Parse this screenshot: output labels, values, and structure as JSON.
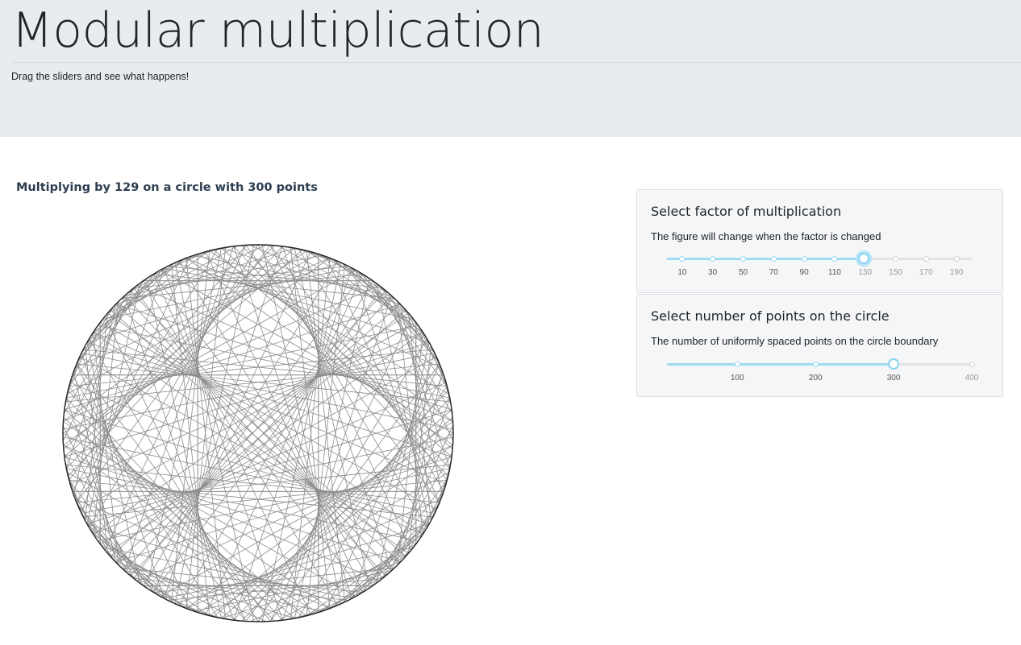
{
  "header": {
    "title": "Modular multiplication",
    "lead": "Drag the sliders and see what happens!"
  },
  "plot": {
    "title": "Multiplying by 129 on a circle with 300 points",
    "factor": 129,
    "points": 300
  },
  "factor_panel": {
    "title": "Select factor of multiplication",
    "description": "The figure will change when the factor is changed",
    "min": 0,
    "max": 200,
    "value": 129,
    "tick_labels": [
      "10",
      "30",
      "50",
      "70",
      "90",
      "110",
      "130",
      "150",
      "170",
      "190"
    ]
  },
  "points_panel": {
    "title": "Select number of points on the circle",
    "description": "The number of uniformly spaced points on the circle boundary",
    "min": 10,
    "max": 400,
    "value": 300,
    "tick_labels": [
      "100",
      "200",
      "300",
      "400"
    ]
  },
  "colors": {
    "header_bg": "#e9ecef",
    "chord": "#8c8c8c",
    "circle_border": "#222222",
    "slider_accent": "#9edcf2",
    "plot_title": "#2c3e50"
  }
}
